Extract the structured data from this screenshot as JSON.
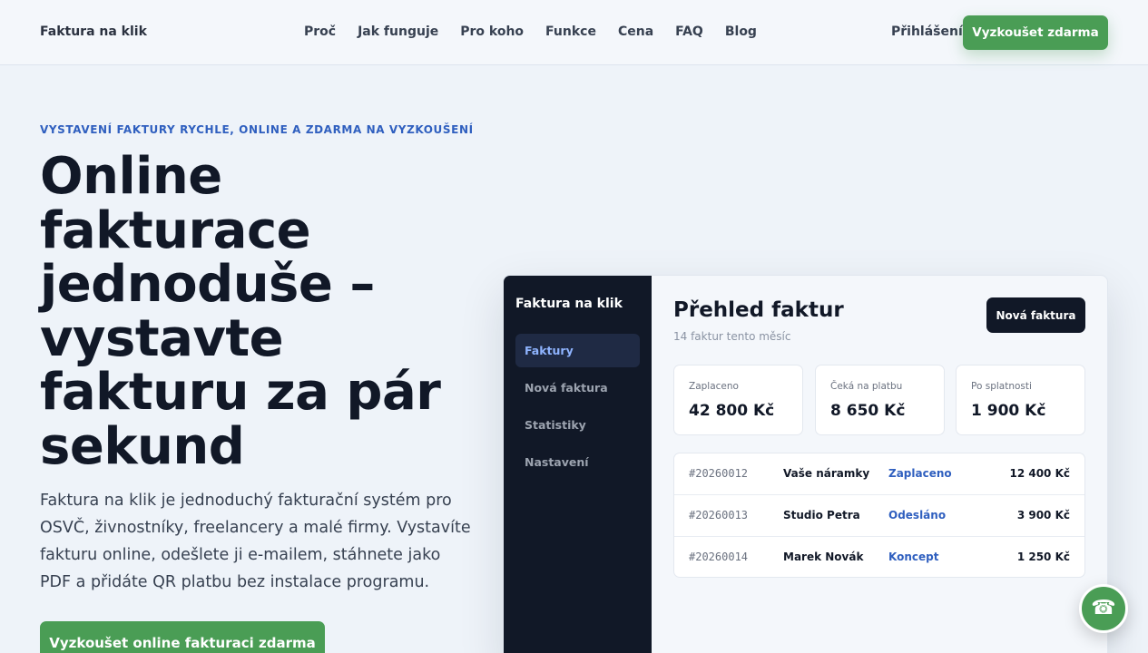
{
  "header": {
    "brand": "Faktura na klik",
    "nav": [
      "Proč",
      "Jak funguje",
      "Pro koho",
      "Funkce",
      "Cena",
      "FAQ",
      "Blog"
    ],
    "login": "Přihlášení",
    "cta": "Vyzkoušet zdarma"
  },
  "hero": {
    "eyebrow": "VYSTAVENÍ FAKTURY RYCHLE, ONLINE A ZDARMA NA VYZKOUŠENÍ",
    "title": "Online fakturace jednoduše – vystavte fakturu za pár sekund",
    "text": "Faktura na klik je jednoduchý fakturační systém pro OSVČ, živnostníky, freelancery a malé firmy. Vystavíte fakturu online, odešlete ji e-mailem, stáhnete jako PDF a přidáte QR platbu bez instalace programu.",
    "cta": "Vyzkoušet online fakturaci zdarma"
  },
  "mock": {
    "brand": "Faktura na klik",
    "sidebar": [
      "Faktury",
      "Nová faktura",
      "Statistiky",
      "Nastavení"
    ],
    "title": "Přehled faktur",
    "subtitle": "14 faktur tento měsíc",
    "new_button": "Nová faktura",
    "stats": [
      {
        "label": "Zaplaceno",
        "value": "42 800 Kč"
      },
      {
        "label": "Čeká na platbu",
        "value": "8 650 Kč"
      },
      {
        "label": "Po splatnosti",
        "value": "1 900 Kč"
      }
    ],
    "rows": [
      {
        "id": "#20260012",
        "name": "Vaše náramky",
        "status": "Zaplaceno",
        "amount": "12 400 Kč"
      },
      {
        "id": "#20260013",
        "name": "Studio Petra",
        "status": "Odesláno",
        "amount": "3 900 Kč"
      },
      {
        "id": "#20260014",
        "name": "Marek Novák",
        "status": "Koncept",
        "amount": "1 250 Kč"
      }
    ]
  },
  "fab": {
    "icon": "phone-icon",
    "glyph": "☎"
  },
  "colors": {
    "accent_green": "#4a9d55",
    "accent_blue": "#2f5fbf",
    "dark": "#111827"
  }
}
